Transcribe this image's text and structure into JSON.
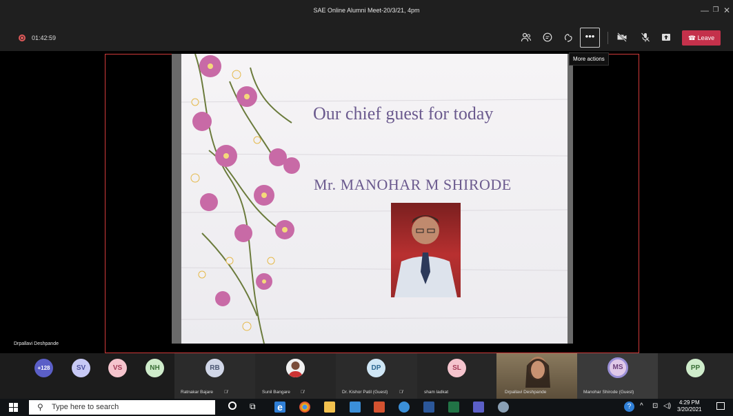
{
  "window": {
    "title": "SAE Online Alumni Meet-20/3/21, 4pm",
    "controls": [
      "minimize-icon",
      "restore-icon",
      "close-icon"
    ]
  },
  "meeting_toolbar": {
    "recording_timer": "01:42:59",
    "icons": [
      "participants-icon",
      "chat-icon",
      "reactions-icon",
      "more-actions-icon",
      "camera-off-icon",
      "mic-off-icon",
      "share-screen-icon"
    ],
    "more_label": "•••",
    "leave_label": "Leave",
    "tooltip": "More actions",
    "accent_color": "#c4314b"
  },
  "stage": {
    "presenter_name": "Drpallavi Deshpande",
    "slide": {
      "title": "Our chief guest for today",
      "name": "Mr. MANOHAR  M  SHIRODE"
    }
  },
  "participants": {
    "overflow_count": "+128",
    "top_avatars": [
      {
        "initials": "SV",
        "color": "#c7c9f5",
        "text": "#4b4f9c"
      },
      {
        "initials": "VS",
        "color": "#f5c4cd",
        "text": "#a33a55"
      },
      {
        "initials": "NH",
        "color": "#cfeccb",
        "text": "#3a6f37"
      }
    ],
    "tiles": [
      {
        "initials": "RB",
        "name": "Ratnakar Bajare",
        "muted": true
      },
      {
        "initials": "",
        "name": "Sunil Bangare",
        "muted": true
      },
      {
        "initials": "DP",
        "name": "Dr. Kishor Patil (Guest)",
        "muted": true
      },
      {
        "initials": "SL",
        "name": "sham ladkat",
        "muted": false
      },
      {
        "initials": "",
        "name": "Drpallavi Deshpande",
        "muted": false
      },
      {
        "initials": "MS",
        "name": "Manohar Shirode (Guest)",
        "muted": false
      },
      {
        "initials": "PP",
        "name": "",
        "muted": false
      }
    ]
  },
  "taskbar": {
    "search_placeholder": "Type here to search",
    "time": "4:29 PM",
    "date": "3/20/2021"
  }
}
